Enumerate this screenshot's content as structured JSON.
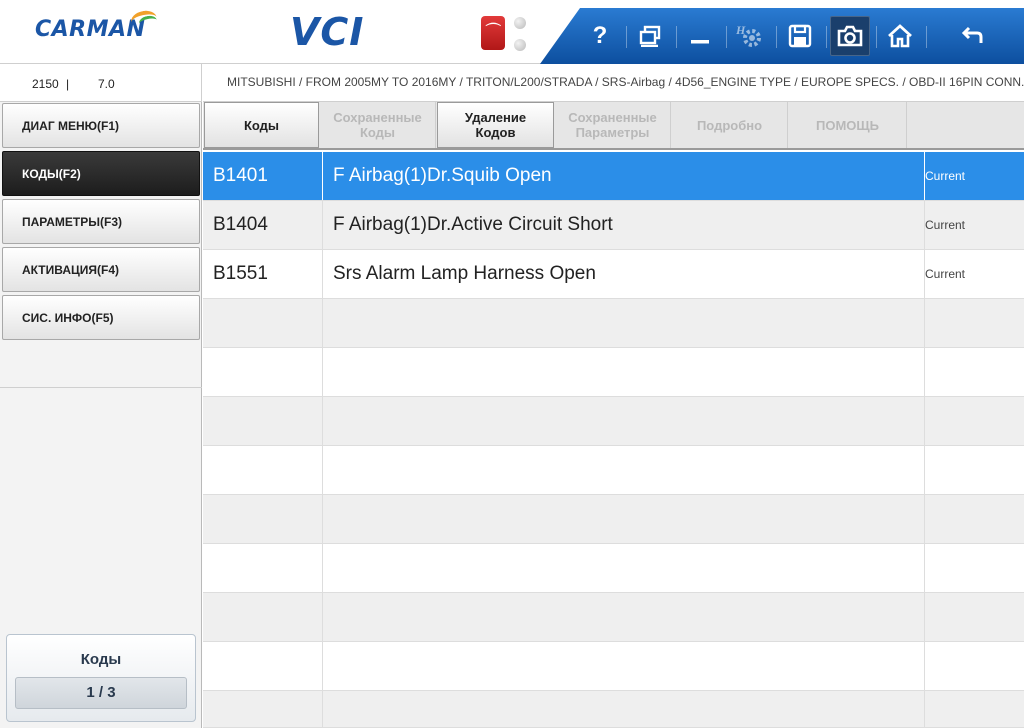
{
  "header": {
    "brand": "CARMAN",
    "product": "VCI",
    "toolbar": {
      "help": "?",
      "icons": [
        "window-icon",
        "minimize-icon",
        "settings-icon",
        "save-icon",
        "camera-icon",
        "home-icon",
        "back-icon"
      ]
    }
  },
  "status": {
    "value1": "2150",
    "separator": "|",
    "value2": "7.0",
    "breadcrumb": "MITSUBISHI / FROM 2005MY TO 2016MY / TRITON/L200/STRADA / SRS-Airbag / 4D56_ENGINE TYPE / EUROPE SPECS. / OBD-II 16PIN CONN..."
  },
  "sidebar": {
    "items": [
      {
        "label": "ДИАГ МЕНЮ(F1)",
        "active": false
      },
      {
        "label": "КОДЫ(F2)",
        "active": true
      },
      {
        "label": "ПАРАМЕТРЫ(F3)",
        "active": false
      },
      {
        "label": "АКТИВАЦИЯ(F4)",
        "active": false
      },
      {
        "label": "СИС. ИНФО(F5)",
        "active": false
      }
    ],
    "panel": {
      "title": "Коды",
      "count": "1 / 3"
    }
  },
  "tabs": [
    {
      "label": "Коды",
      "enabled": true
    },
    {
      "label": "Сохраненные Коды",
      "enabled": false
    },
    {
      "label": "Удаление Кодов",
      "enabled": true
    },
    {
      "label": "Сохраненные Параметры",
      "enabled": false
    },
    {
      "label": "Подробно",
      "enabled": false
    },
    {
      "label": "ПОМОЩЬ",
      "enabled": false
    }
  ],
  "codes": [
    {
      "code": "B1401",
      "description": "F Airbag(1)Dr.Squib Open",
      "status": "Current",
      "selected": true
    },
    {
      "code": "B1404",
      "description": "F Airbag(1)Dr.Active Circuit Short",
      "status": "Current",
      "selected": false
    },
    {
      "code": "B1551",
      "description": "Srs Alarm Lamp Harness Open",
      "status": "Current",
      "selected": false
    }
  ],
  "colors": {
    "accent": "#2b8ee8",
    "toolbar": "#1560b5",
    "brand": "#1b56a6",
    "usb": "#d42a2a"
  }
}
